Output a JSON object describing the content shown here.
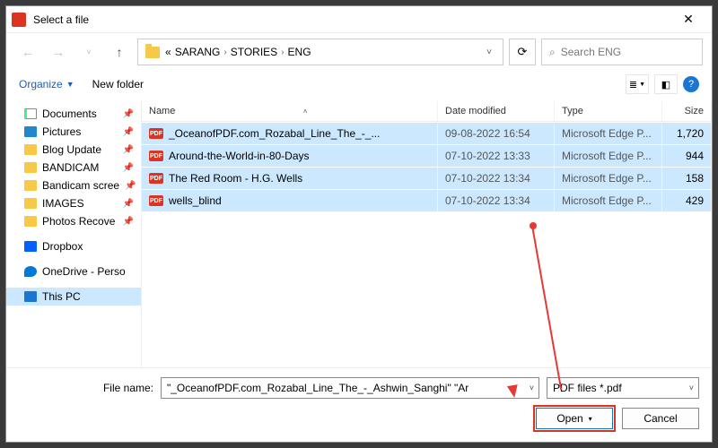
{
  "title": "Select a file",
  "breadcrumb": {
    "p0": "«",
    "p1": "SARANG",
    "p2": "STORIES",
    "p3": "ENG"
  },
  "search_placeholder": "Search ENG",
  "toolbar": {
    "organize": "Organize",
    "newfolder": "New folder"
  },
  "columns": {
    "name": "Name",
    "date": "Date modified",
    "type": "Type",
    "size": "Size"
  },
  "sidebar": [
    {
      "label": "Documents",
      "ico": "docs",
      "pin": true
    },
    {
      "label": "Pictures",
      "ico": "pics",
      "pin": true
    },
    {
      "label": "Blog Update",
      "ico": "f",
      "pin": true
    },
    {
      "label": "BANDICAM",
      "ico": "f",
      "pin": true
    },
    {
      "label": "Bandicam scree",
      "ico": "f",
      "pin": true
    },
    {
      "label": "IMAGES",
      "ico": "f",
      "pin": true
    },
    {
      "label": "Photos Recove",
      "ico": "f",
      "pin": true
    },
    {
      "label": "Dropbox",
      "ico": "dropbox",
      "pin": false,
      "spaced": true
    },
    {
      "label": "OneDrive - Perso",
      "ico": "onedrive",
      "pin": false,
      "spaced": true
    },
    {
      "label": "This PC",
      "ico": "thispc",
      "pin": false,
      "spaced": true,
      "selected": true
    }
  ],
  "files": [
    {
      "name": "_OceanofPDF.com_Rozabal_Line_The_-_...",
      "date": "09-08-2022 16:54",
      "type": "Microsoft Edge P...",
      "size": "1,720"
    },
    {
      "name": "Around-the-World-in-80-Days",
      "date": "07-10-2022 13:33",
      "type": "Microsoft Edge P...",
      "size": "944"
    },
    {
      "name": "The Red Room - H.G. Wells",
      "date": "07-10-2022 13:34",
      "type": "Microsoft Edge P...",
      "size": "158"
    },
    {
      "name": "wells_blind",
      "date": "07-10-2022 13:34",
      "type": "Microsoft Edge P...",
      "size": "429"
    }
  ],
  "footer": {
    "filename_label": "File name:",
    "filename_value": "\"_OceanofPDF.com_Rozabal_Line_The_-_Ashwin_Sanghi\" \"Ar",
    "filter": "PDF files *.pdf",
    "open": "Open",
    "cancel": "Cancel"
  }
}
